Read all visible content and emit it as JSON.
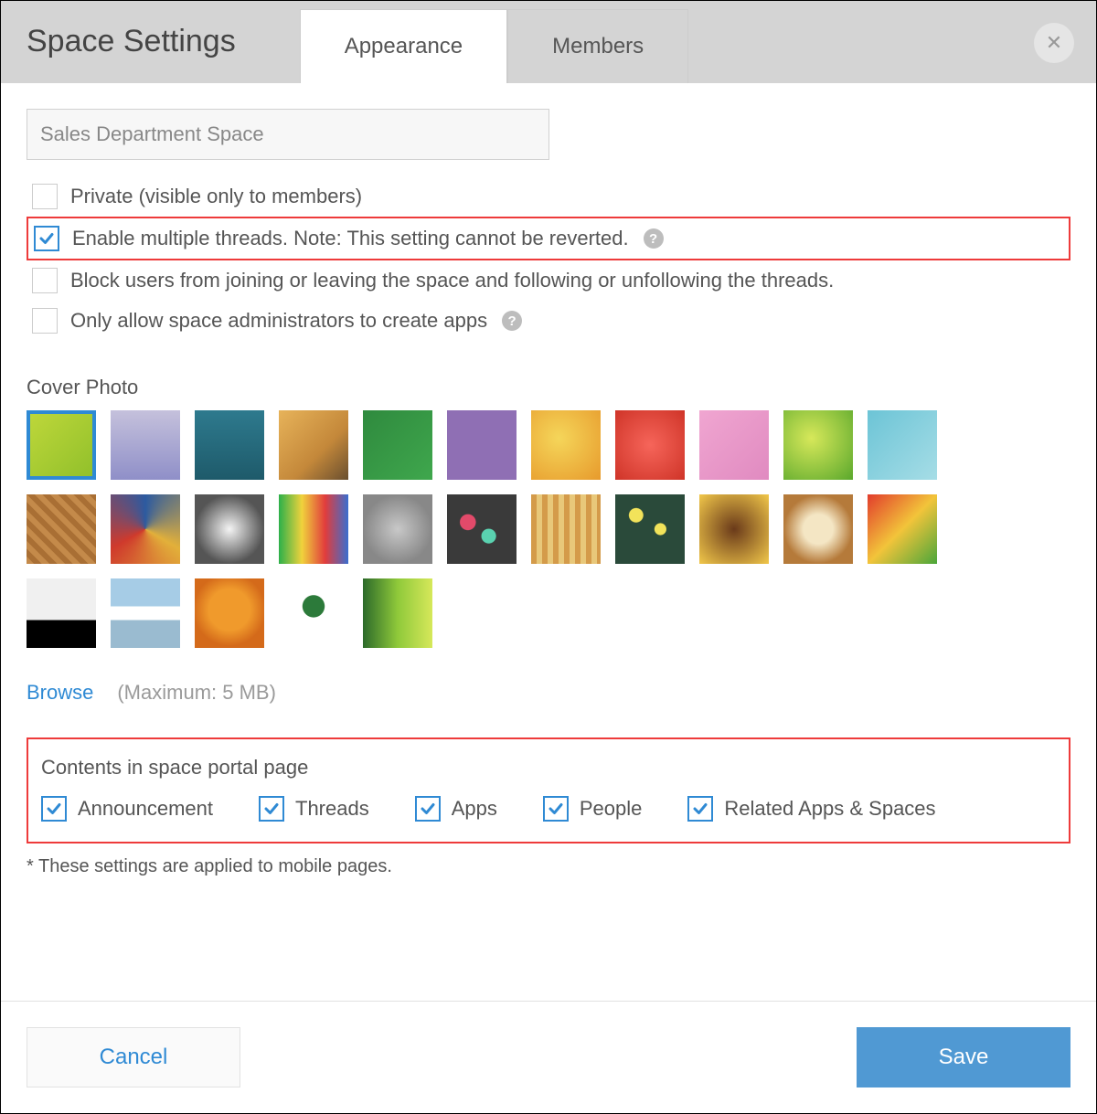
{
  "header": {
    "title": "Space Settings",
    "tabs": [
      {
        "label": "Appearance",
        "active": true
      },
      {
        "label": "Members",
        "active": false
      }
    ]
  },
  "form": {
    "space_name": "Sales Department Space",
    "options": [
      {
        "label": "Private (visible only to members)",
        "checked": false,
        "help": false,
        "highlight": false
      },
      {
        "label": "Enable multiple threads. Note: This setting cannot be reverted.",
        "checked": true,
        "help": true,
        "highlight": true
      },
      {
        "label": "Block users from joining or leaving the space and following or unfollowing the threads.",
        "checked": false,
        "help": false,
        "highlight": false
      },
      {
        "label": "Only allow space administrators to create apps",
        "checked": false,
        "help": true,
        "highlight": false
      }
    ],
    "cover_label": "Cover Photo",
    "browse_label": "Browse",
    "browse_hint": "(Maximum: 5 MB)",
    "cover_selected_index": 0,
    "cover_count": 27,
    "portal": {
      "title": "Contents in space portal page",
      "items": [
        {
          "label": "Announcement",
          "checked": true
        },
        {
          "label": "Threads",
          "checked": true
        },
        {
          "label": "Apps",
          "checked": true
        },
        {
          "label": "People",
          "checked": true
        },
        {
          "label": "Related Apps & Spaces",
          "checked": true
        }
      ]
    },
    "note": "* These settings are applied to mobile pages."
  },
  "footer": {
    "cancel": "Cancel",
    "save": "Save"
  }
}
